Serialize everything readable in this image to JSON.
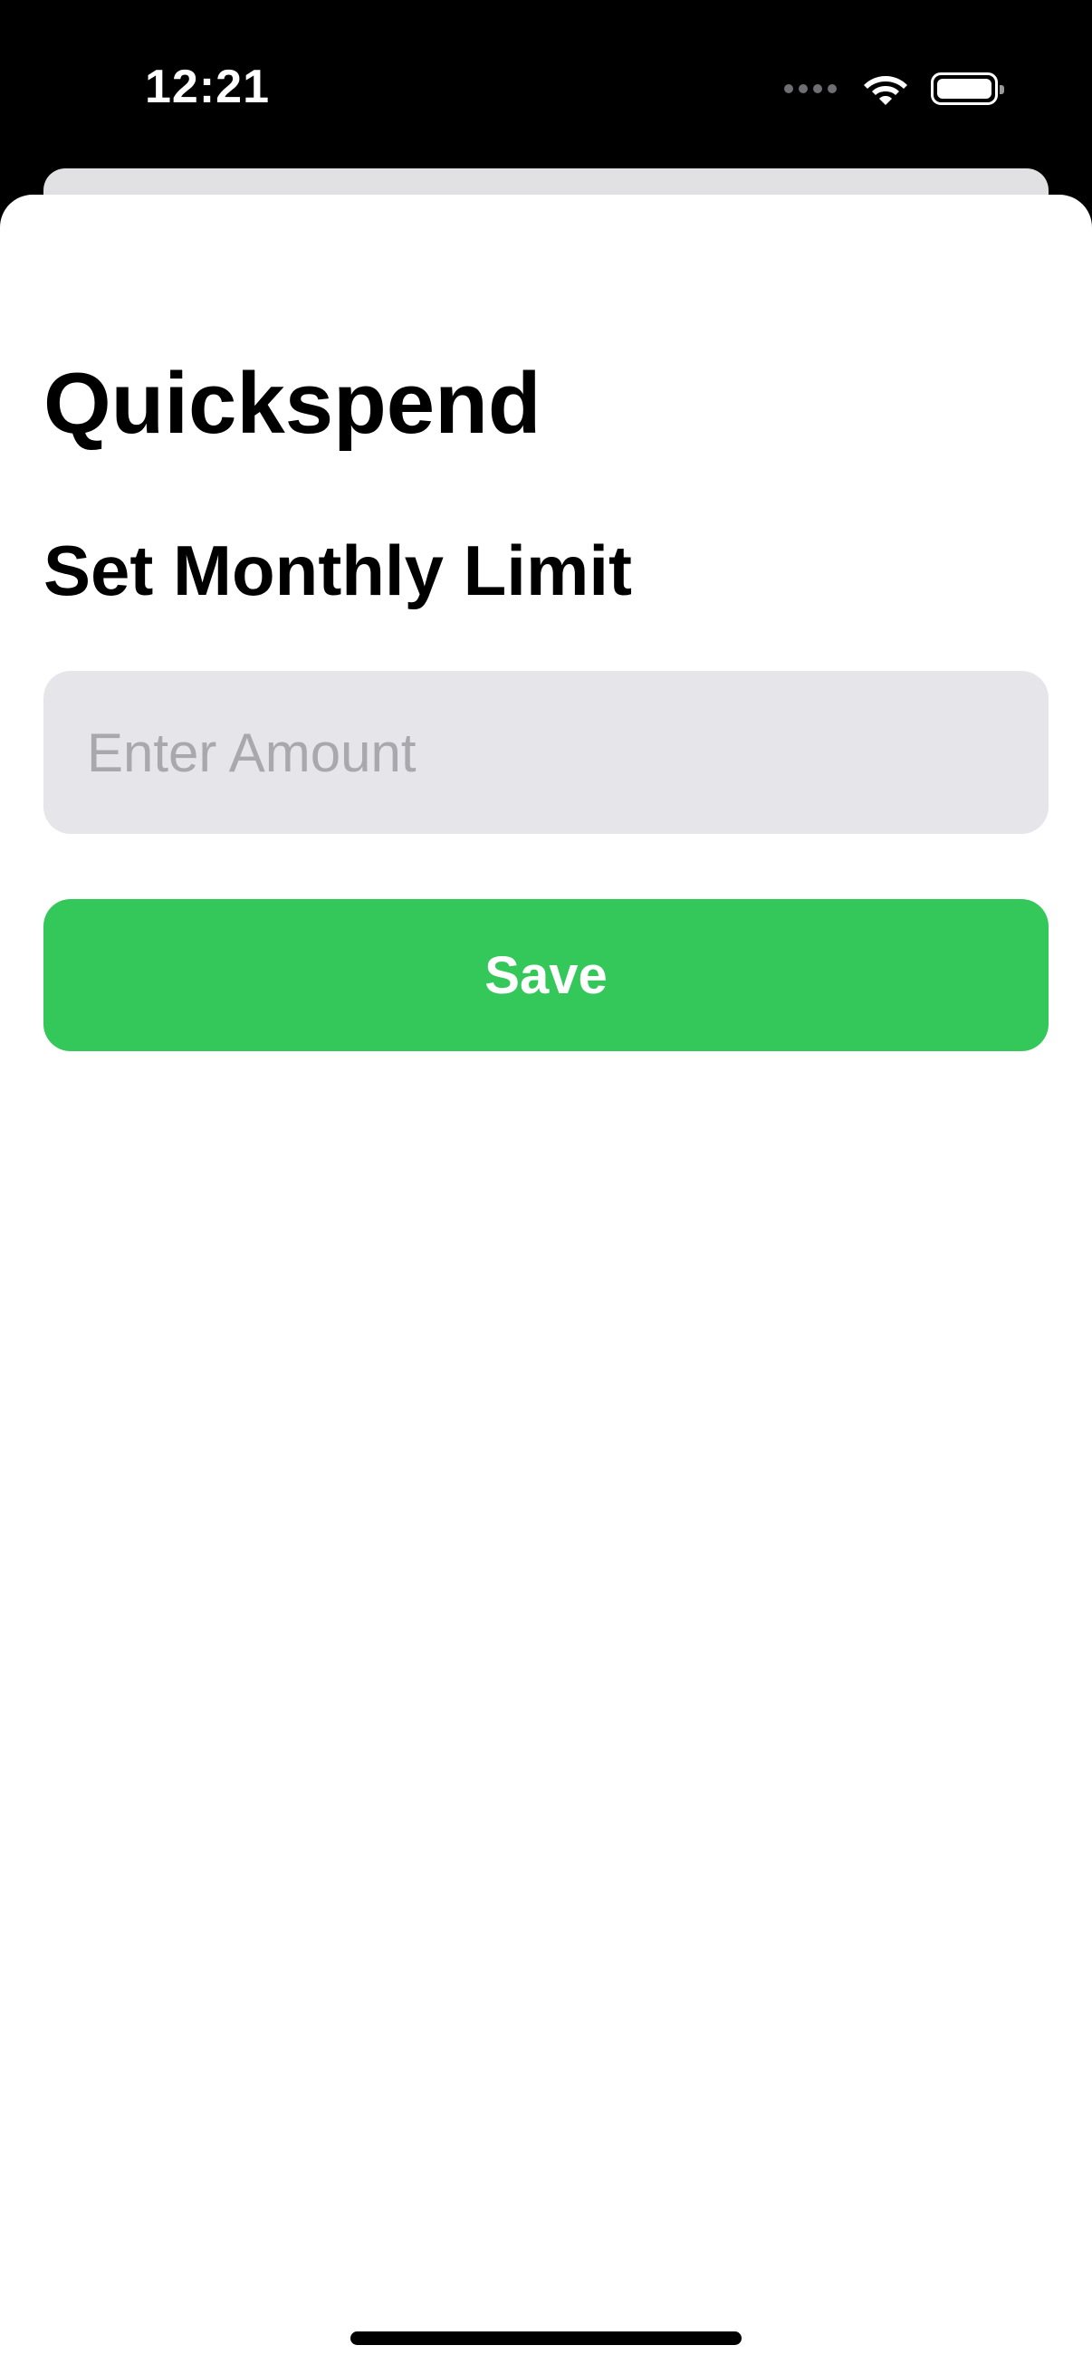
{
  "status_bar": {
    "time": "12:21",
    "icons": [
      "cellular-signal-icon",
      "wifi-icon",
      "battery-icon"
    ]
  },
  "sheet": {
    "app_title": "Quickspend",
    "section_title": "Set Monthly Limit",
    "amount_field": {
      "value": "",
      "placeholder": "Enter Amount"
    },
    "save_button": {
      "label": "Save"
    }
  },
  "colors": {
    "accent": "#34c85a",
    "field_background": "#e5e5ea",
    "placeholder": "#a8a8ad",
    "status_bar_background": "#000000",
    "sheet_background": "#ffffff"
  }
}
